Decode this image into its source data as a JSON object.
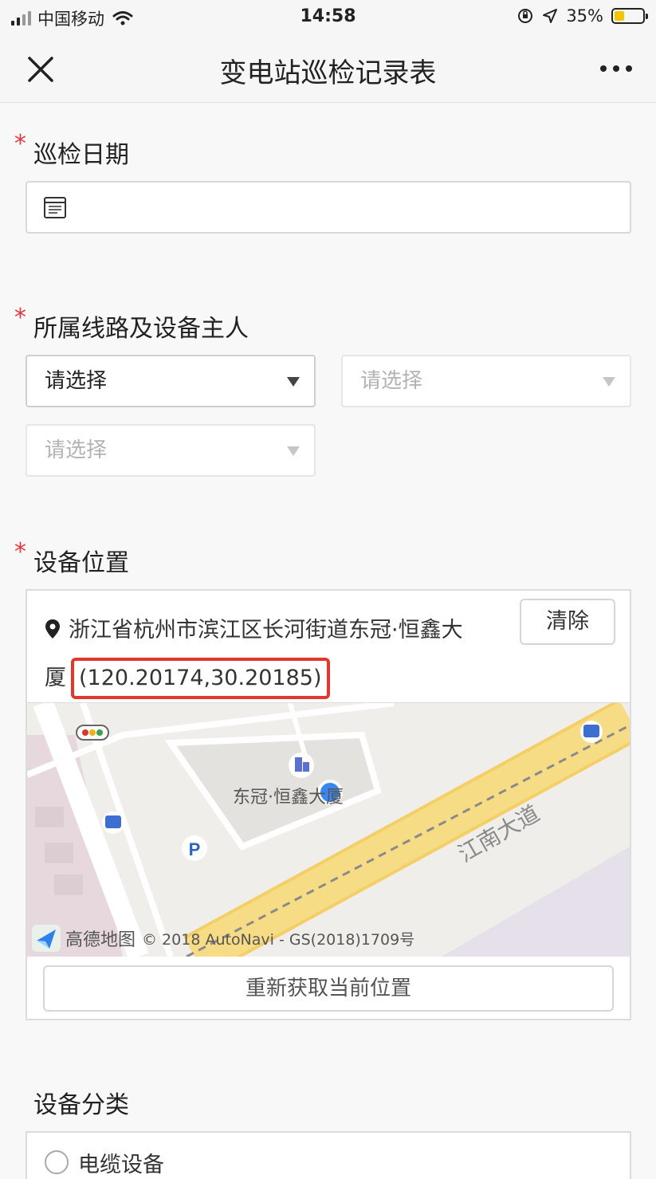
{
  "status_bar": {
    "carrier": "中国移动",
    "time": "14:58",
    "battery": "35%",
    "battery_level": 0.35,
    "icons": [
      "signal-icon",
      "wifi-icon",
      "orientation-lock-icon",
      "location-arrow-icon",
      "battery-icon"
    ]
  },
  "nav": {
    "title": "变电站巡检记录表",
    "close_icon": "close-icon",
    "more_icon": "more-icon"
  },
  "form": {
    "date_field": {
      "label": "巡检日期",
      "required": "*",
      "icon": "calendar-icon",
      "value": ""
    },
    "owner_field": {
      "label": "所属线路及设备主人",
      "required": "*",
      "selects": [
        {
          "placeholder": "请选择",
          "state": "enabled"
        },
        {
          "placeholder": "请选择",
          "state": "disabled"
        },
        {
          "placeholder": "请选择",
          "state": "disabled"
        }
      ]
    },
    "location_field": {
      "label": "设备位置",
      "required": "*",
      "address_line1": "浙江省杭州市滨江区长河街道东冠·恒鑫大",
      "address_line2": "厦",
      "coordinates": "(120.20174,30.20185)",
      "clear_label": "清除",
      "map": {
        "poi_label": "东冠·恒鑫大厦",
        "road_label": "江南大道",
        "provider": "高德地图",
        "copyright": "© 2018 AutoNavi - GS(2018)1709号",
        "parking_label": "P"
      },
      "relocate_label": "重新获取当前位置"
    },
    "category_field": {
      "label": "设备分类",
      "first_option": "电缆设备"
    }
  },
  "colors": {
    "required_star": "#e0383e",
    "highlight_box": "#e5362b",
    "location_dot": "#3a87f4",
    "road": "#f7d877",
    "battery_fill": "#f5c400"
  }
}
